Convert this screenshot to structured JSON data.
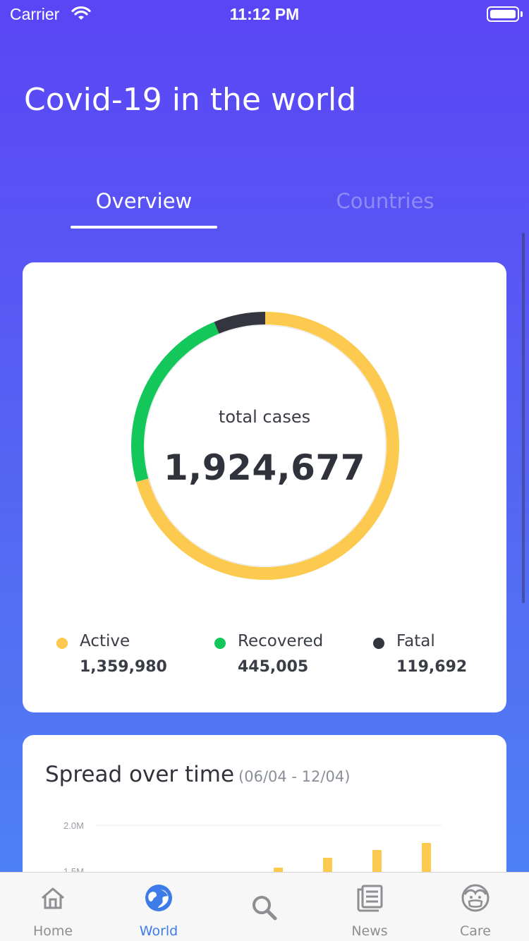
{
  "status_bar": {
    "carrier": "Carrier",
    "time": "11:12 PM"
  },
  "page_title": "Covid-19 in the world",
  "tabs": [
    {
      "label": "Overview",
      "selected": true
    },
    {
      "label": "Countries",
      "selected": false
    }
  ],
  "overview": {
    "center_label": "total cases",
    "total": "1,924,677",
    "legend": [
      {
        "label": "Active",
        "value": "1,359,980",
        "color": "#fcca4f"
      },
      {
        "label": "Recovered",
        "value": "445,005",
        "color": "#13c75a"
      },
      {
        "label": "Fatal",
        "value": "119,692",
        "color": "#33363e"
      }
    ]
  },
  "chart_data": {
    "type": "pie",
    "title": "",
    "categories": [
      "Active",
      "Recovered",
      "Fatal"
    ],
    "values": [
      1359980,
      445005,
      119692
    ],
    "colors": [
      "#fcca4f",
      "#13c75a",
      "#33363e"
    ]
  },
  "spread": {
    "title": "Spread over time",
    "range": "(06/04 - 12/04)",
    "y_ticks": [
      "2.0M",
      "1.5M"
    ]
  },
  "tab_bar": {
    "items": [
      {
        "label": "Home",
        "icon": "home-icon",
        "active": false
      },
      {
        "label": "World",
        "icon": "globe-icon",
        "active": true
      },
      {
        "label": "",
        "icon": "search-icon",
        "active": false
      },
      {
        "label": "News",
        "icon": "news-icon",
        "active": false
      },
      {
        "label": "Care",
        "icon": "mask-face-icon",
        "active": false
      }
    ],
    "active_color": "#3d7ce8",
    "inactive_color": "#8e8e93"
  }
}
